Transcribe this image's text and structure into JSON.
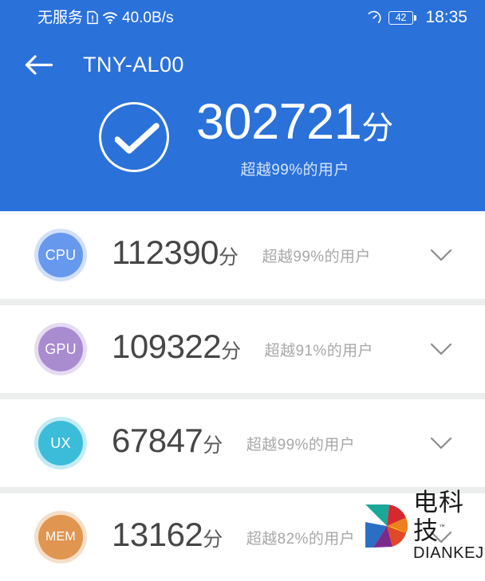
{
  "status_bar": {
    "carrier": "无服务",
    "sim_icon": "sim-alert-icon",
    "wifi_icon": "wifi-icon",
    "network_speed": "40.0B/s",
    "speed_meter_icon": "speedometer-icon",
    "battery_level": "42",
    "battery_icon": "battery-icon",
    "clock": "18:35"
  },
  "titlebar": {
    "back_icon": "arrow-left-icon",
    "title": "TNY-AL00"
  },
  "hero": {
    "check_icon": "check-circle-icon",
    "total_score": "302721",
    "unit": "分",
    "subtitle": "超越99%的用户"
  },
  "colors": {
    "header_blue": "#2a71da",
    "cpu": "#6699ee",
    "gpu": "#a98bd0",
    "ux": "#3bbcd9",
    "mem": "#e09550",
    "score_text": "#464646",
    "sub_text": "#a8a8a8",
    "divider": "#eceded"
  },
  "list": {
    "chevron_icon": "chevron-down-icon",
    "rows": [
      {
        "label": "CPU",
        "score": "112390",
        "unit": "分",
        "sub": "超越99%的用户",
        "color": "#6699ee"
      },
      {
        "label": "GPU",
        "score": "109322",
        "unit": "分",
        "sub": "超越91%的用户",
        "color": "#a98bd0"
      },
      {
        "label": "UX",
        "score": "67847",
        "unit": "分",
        "sub": "超越99%的用户",
        "color": "#3bbcd9"
      },
      {
        "label": "MEM",
        "score": "13162",
        "unit": "分",
        "sub": "超越82%的用户",
        "color": "#e09550"
      }
    ]
  },
  "watermark": {
    "logo_icon": "diankeji-pinwheel-logo",
    "cn_name": "电科技",
    "trademark": "™",
    "en_name": "DIANKEJI"
  }
}
